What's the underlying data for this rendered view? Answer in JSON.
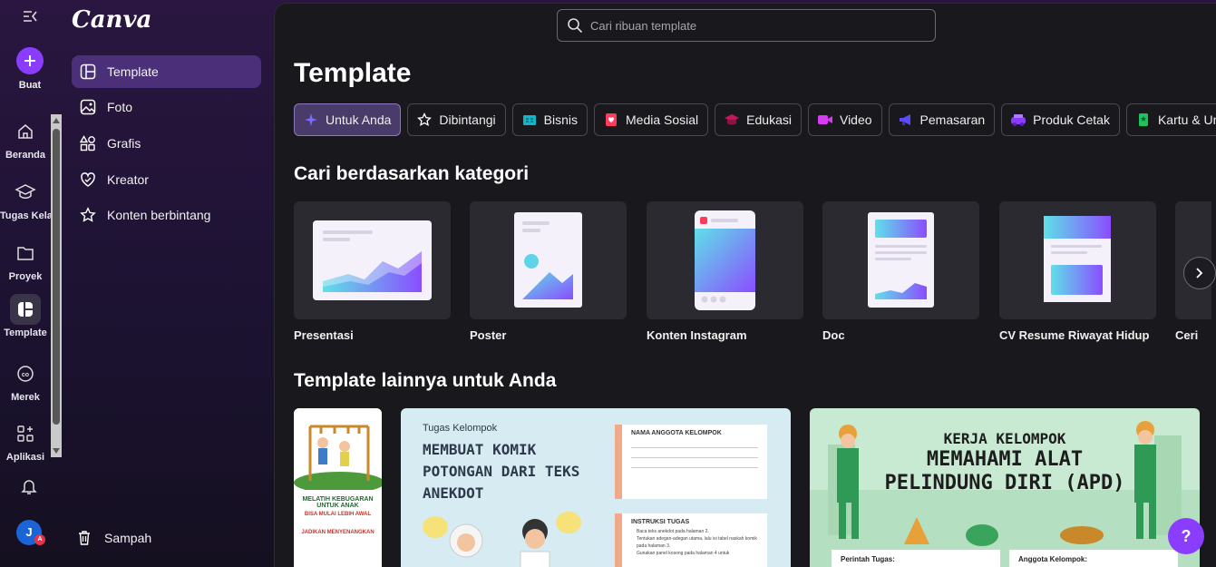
{
  "rail": {
    "buat_label": "Buat",
    "items": [
      {
        "label": "Beranda",
        "icon": "home-icon"
      },
      {
        "label": "Tugas Kelas",
        "icon": "graduation-cap-icon"
      },
      {
        "label": "Proyek",
        "icon": "folder-icon"
      },
      {
        "label": "Template",
        "icon": "template-icon"
      },
      {
        "label": "Merek",
        "icon": "brand-icon"
      },
      {
        "label": "Aplikasi",
        "icon": "apps-icon"
      }
    ],
    "avatar_initial": "J",
    "avatar_badge": "A"
  },
  "sidebar": {
    "logo": "Canva",
    "items": [
      {
        "label": "Template",
        "icon": "template-icon"
      },
      {
        "label": "Foto",
        "icon": "photo-icon"
      },
      {
        "label": "Grafis",
        "icon": "shapes-icon"
      },
      {
        "label": "Kreator",
        "icon": "heart-icon"
      },
      {
        "label": "Konten berbintang",
        "icon": "star-icon"
      }
    ],
    "trash_label": "Sampah"
  },
  "search": {
    "placeholder": "Cari ribuan template"
  },
  "main": {
    "title": "Template",
    "chips": [
      {
        "label": "Untuk Anda",
        "icon": "sparkle-icon",
        "color": "#7b6cff"
      },
      {
        "label": "Dibintangi",
        "icon": "star-icon",
        "color": "#ffffff"
      },
      {
        "label": "Bisnis",
        "icon": "briefcase-icon",
        "color": "#13b5c9"
      },
      {
        "label": "Media Sosial",
        "icon": "heart-icon",
        "color": "#ff3b5c"
      },
      {
        "label": "Edukasi",
        "icon": "graduation-cap-icon",
        "color": "#c2185b"
      },
      {
        "label": "Video",
        "icon": "video-icon",
        "color": "#d63cf2"
      },
      {
        "label": "Pemasaran",
        "icon": "megaphone-icon",
        "color": "#5a4bff"
      },
      {
        "label": "Produk Cetak",
        "icon": "print-icon",
        "color": "#8b3dff"
      },
      {
        "label": "Kartu & Un",
        "icon": "card-icon",
        "color": "#1ec25a"
      }
    ],
    "category_heading": "Cari berdasarkan kategori",
    "categories": [
      {
        "label": "Presentasi"
      },
      {
        "label": "Poster"
      },
      {
        "label": "Konten Instagram"
      },
      {
        "label": "Doc"
      },
      {
        "label": "CV Resume Riwayat Hidup"
      },
      {
        "label": "Ceri"
      }
    ],
    "more_heading": "Template lainnya untuk Anda",
    "templates": [
      {
        "lines": [
          "MELATIH KEBUGARAN",
          "UNTUK ANAK",
          "BISA MULAI LEBIH AWAL",
          "JADIKAN MENYENANGKAN"
        ]
      },
      {
        "kicker": "Tugas Kelompok",
        "title_lines": [
          "MEMBUAT KOMIK",
          "POTONGAN DARI TEKS",
          "ANEKDOT"
        ],
        "box1": "NAMA ANGGOTA KELOMPOK",
        "box2": "INSTRUKSI TUGAS",
        "instructions": [
          "Baca teks anekdot pada halaman 2.",
          "Tentukan adegan-adegan utama, lalu isi tabel naskah komik pada halaman 3.",
          "Gunakan panel kosong pada halaman 4 untuk"
        ]
      },
      {
        "title_lines": [
          "KERJA KELOMPOK",
          "MEMAHAMI ALAT",
          "PELINDUNG DIRI (APD)"
        ],
        "box1": "Perintah Tugas:",
        "box2": "Anggota Kelompok:"
      }
    ],
    "help_label": "?"
  }
}
